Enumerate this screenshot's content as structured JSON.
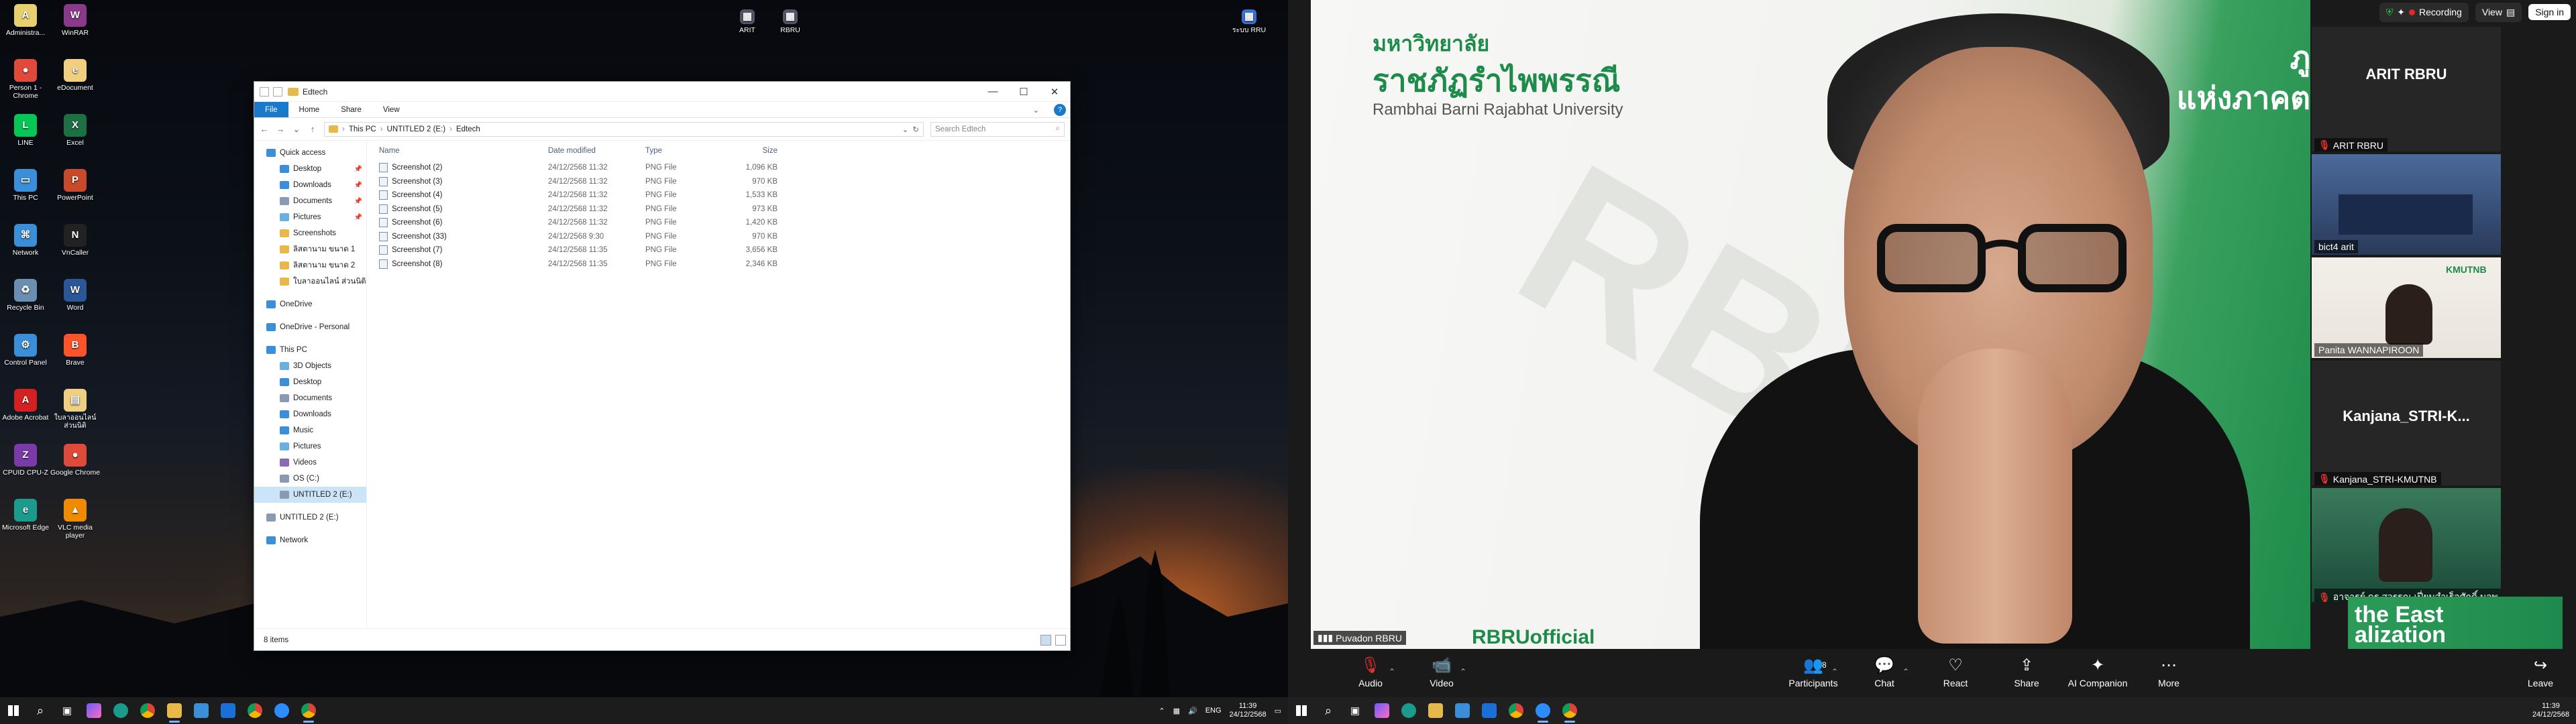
{
  "desktop_icons": [
    {
      "label": "Administra...",
      "color": "#e8d070",
      "glyph": "A",
      "icon": "document-icon"
    },
    {
      "label": "WinRAR",
      "color": "#8b3a8b",
      "glyph": "W",
      "icon": "winrar-icon"
    },
    {
      "label": "Person 1 - Chrome",
      "color": "#e04a3a",
      "glyph": "●",
      "icon": "chrome-icon"
    },
    {
      "label": "eDocument",
      "color": "#f0d080",
      "glyph": "e",
      "icon": "edocument-icon"
    },
    {
      "label": "LINE",
      "color": "#06c755",
      "glyph": "L",
      "icon": "line-icon"
    },
    {
      "label": "Excel",
      "color": "#1d7044",
      "glyph": "X",
      "icon": "excel-icon"
    },
    {
      "label": "This PC",
      "color": "#3a8fd8",
      "glyph": "▭",
      "icon": "this-pc-icon"
    },
    {
      "label": "PowerPoint",
      "color": "#c94a2a",
      "glyph": "P",
      "icon": "powerpoint-icon"
    },
    {
      "label": "Network",
      "color": "#3a8fd8",
      "glyph": "⌘",
      "icon": "network-icon"
    },
    {
      "label": "VnCaller",
      "color": "#222222",
      "glyph": "N",
      "icon": "vncaller-icon"
    },
    {
      "label": "Recycle Bin",
      "color": "#6a8fb0",
      "glyph": "♻",
      "icon": "recycle-bin-icon"
    },
    {
      "label": "Word",
      "color": "#2b5797",
      "glyph": "W",
      "icon": "word-icon"
    },
    {
      "label": "Control Panel",
      "color": "#3a8fd8",
      "glyph": "⚙",
      "icon": "control-panel-icon"
    },
    {
      "label": "Brave",
      "color": "#fb542b",
      "glyph": "B",
      "icon": "brave-icon"
    },
    {
      "label": "Adobe Acrobat",
      "color": "#d42020",
      "glyph": "A",
      "icon": "acrobat-icon"
    },
    {
      "label": "ใบลาออนไลน์ ส่วนนิติ",
      "color": "#f0d080",
      "glyph": "▤",
      "icon": "file-icon"
    },
    {
      "label": "CPUID CPU-Z",
      "color": "#7a3aa8",
      "glyph": "Z",
      "icon": "cpuz-icon"
    },
    {
      "label": "Google Chrome",
      "color": "#e04a3a",
      "glyph": "●",
      "icon": "chrome-icon"
    },
    {
      "label": "Microsoft Edge",
      "color": "#1a9b8c",
      "glyph": "e",
      "icon": "edge-icon"
    },
    {
      "label": "VLC media player",
      "color": "#f08a00",
      "glyph": "▲",
      "icon": "vlc-icon"
    }
  ],
  "top_desktop_icons": [
    {
      "label": "ARIT",
      "icon": "arit-icon"
    },
    {
      "label": "RBRU",
      "icon": "rbru-icon"
    },
    {
      "label": "ระบบ RRU",
      "icon": "rru-icon"
    }
  ],
  "explorer": {
    "title": "Edtech",
    "ribbon_tabs": [
      "File",
      "Home",
      "Share",
      "View"
    ],
    "breadcrumb": [
      "This PC",
      "UNTITLED 2 (E:)",
      "Edtech"
    ],
    "search_placeholder": "Search Edtech",
    "nav": [
      {
        "label": "Quick access",
        "level": 1,
        "color": "#3a8fd8"
      },
      {
        "label": "Desktop",
        "level": 2,
        "color": "#3a8fd8",
        "pin": true
      },
      {
        "label": "Downloads",
        "level": 2,
        "color": "#3a8fd8",
        "pin": true
      },
      {
        "label": "Documents",
        "level": 2,
        "color": "#8a9ab0",
        "pin": true
      },
      {
        "label": "Pictures",
        "level": 2,
        "color": "#6ab0e0",
        "pin": true
      },
      {
        "label": "Screenshots",
        "level": 2,
        "color": "#e6b94a"
      },
      {
        "label": "ลิสตานาม ขนาด 1",
        "level": 2,
        "color": "#e6b94a"
      },
      {
        "label": "ลิสตานาม ขนาด 2",
        "level": 2,
        "color": "#e6b94a"
      },
      {
        "label": "ใบลาออนไลน์ ส่วนนิติ",
        "level": 2,
        "color": "#e6b94a"
      },
      {
        "label": "OneDrive",
        "level": 1,
        "color": "#3a8fd8",
        "gap": true
      },
      {
        "label": "OneDrive - Personal",
        "level": 1,
        "color": "#3a8fd8",
        "gap": true
      },
      {
        "label": "This PC",
        "level": 1,
        "color": "#3a8fd8",
        "gap": true
      },
      {
        "label": "3D Objects",
        "level": 2,
        "color": "#6ab0e0"
      },
      {
        "label": "Desktop",
        "level": 2,
        "color": "#3a8fd8"
      },
      {
        "label": "Documents",
        "level": 2,
        "color": "#8a9ab0"
      },
      {
        "label": "Downloads",
        "level": 2,
        "color": "#3a8fd8"
      },
      {
        "label": "Music",
        "level": 2,
        "color": "#3a8fd8"
      },
      {
        "label": "Pictures",
        "level": 2,
        "color": "#6ab0e0"
      },
      {
        "label": "Videos",
        "level": 2,
        "color": "#8a6ab0"
      },
      {
        "label": "OS (C:)",
        "level": 2,
        "color": "#8a9ab0"
      },
      {
        "label": "UNTITLED 2 (E:)",
        "level": 2,
        "color": "#8a9ab0",
        "selected": true
      },
      {
        "label": "UNTITLED 2 (E:)",
        "level": 1,
        "color": "#8a9ab0",
        "gap": true
      },
      {
        "label": "Network",
        "level": 1,
        "color": "#3a8fd8",
        "gap": true
      }
    ],
    "columns": {
      "name": "Name",
      "date": "Date modified",
      "type": "Type",
      "size": "Size"
    },
    "files": [
      {
        "name": "Screenshot (2)",
        "date": "24/12/2568 11:32",
        "type": "PNG File",
        "size": "1,096 KB"
      },
      {
        "name": "Screenshot (3)",
        "date": "24/12/2568 11:32",
        "type": "PNG File",
        "size": "970 KB"
      },
      {
        "name": "Screenshot (4)",
        "date": "24/12/2568 11:32",
        "type": "PNG File",
        "size": "1,533 KB"
      },
      {
        "name": "Screenshot (5)",
        "date": "24/12/2568 11:32",
        "type": "PNG File",
        "size": "973 KB"
      },
      {
        "name": "Screenshot (6)",
        "date": "24/12/2568 11:32",
        "type": "PNG File",
        "size": "1,420 KB"
      },
      {
        "name": "Screenshot (33)",
        "date": "24/12/2568 9:30",
        "type": "PNG File",
        "size": "970 KB"
      },
      {
        "name": "Screenshot (7)",
        "date": "24/12/2568 11:35",
        "type": "PNG File",
        "size": "3,656 KB"
      },
      {
        "name": "Screenshot (8)",
        "date": "24/12/2568 11:35",
        "type": "PNG File",
        "size": "2,346 KB"
      }
    ],
    "status": "8 items"
  },
  "taskbar_left": {
    "lang": "ENG",
    "time": "11:39",
    "date": "24/12/2568"
  },
  "taskbar_right": {
    "time": "11:39",
    "date": "24/12/2568"
  },
  "zoom": {
    "recording_label": "Recording",
    "view_label": "View",
    "signin_label": "Sign in",
    "speaker_name": "Puvadon RBRU",
    "slide_th_line1": "มหาวิทยาลัย",
    "slide_th_line2": "ราชภัฏรำไพพรรณี",
    "slide_en": "Rambhai Barni Rajabhat University",
    "slide_right_top": "ภู",
    "slide_right": "แห่งภาคต",
    "slide_bottom": "RBRUofficial",
    "tiles": [
      {
        "big_name": "ARIT RBRU",
        "label": "ARIT RBRU",
        "type": "name"
      },
      {
        "label": "bict4 arit",
        "type": "video"
      },
      {
        "label": "Panita WANNAPIROON",
        "type": "video"
      },
      {
        "big_name": "Kanjana_STRI-K...",
        "label": "Kanjana_STRI-KMUTNB",
        "type": "name"
      },
      {
        "label": "อาจารย์ ดร.สุวรรณ เปี่ยมสำเร็จศักดิ์ มจพ.ก...",
        "type": "video"
      }
    ],
    "gallery_bottom_text": "the East\nalization",
    "toolbar": [
      {
        "label": "Audio",
        "icon": "mic-off-icon",
        "glyph": "🎙",
        "strike": true,
        "caret": true
      },
      {
        "label": "Video",
        "icon": "video-off-icon",
        "glyph": "📹",
        "strike": true,
        "caret": true
      },
      {
        "label": "Participants",
        "icon": "participants-icon",
        "glyph": "👥",
        "count": "8",
        "caret": true
      },
      {
        "label": "Chat",
        "icon": "chat-icon",
        "glyph": "💬",
        "caret": true
      },
      {
        "label": "React",
        "icon": "react-icon",
        "glyph": "♡"
      },
      {
        "label": "Share",
        "icon": "share-icon",
        "glyph": "⇪"
      },
      {
        "label": "AI Companion",
        "icon": "ai-companion-icon",
        "glyph": "✦"
      },
      {
        "label": "More",
        "icon": "more-icon",
        "glyph": "⋯"
      }
    ],
    "leave_label": "Leave"
  }
}
